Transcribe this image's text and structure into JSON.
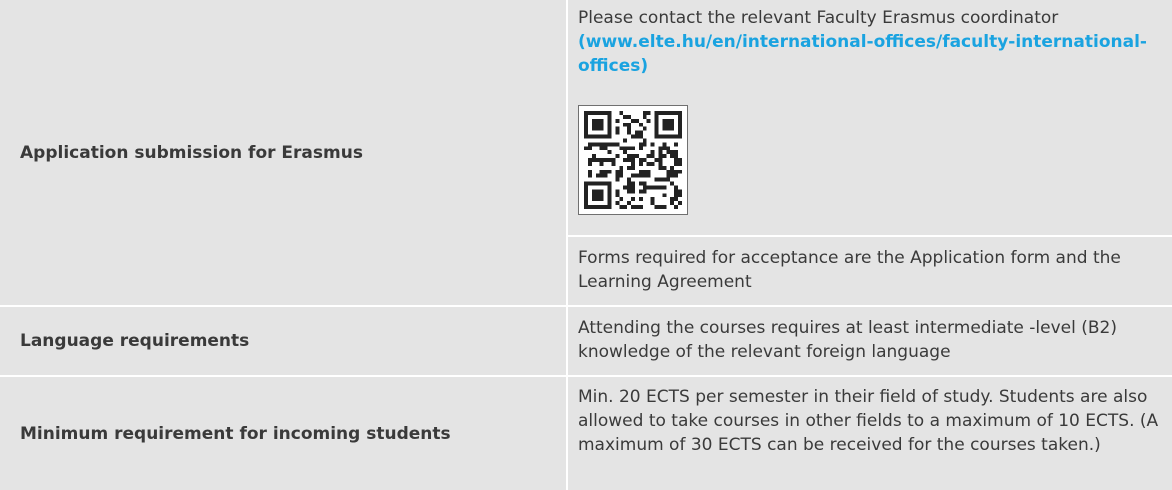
{
  "rows": [
    {
      "label": "Application submission for Erasmus",
      "contact_text": "Please contact the relevant Faculty Erasmus coordinator",
      "link_text": "(www.elte.hu/en/international-offices/faculty-international-offices)",
      "qr_icon": "qr-code-icon",
      "forms_text": "Forms required for acceptance are the Application form and the Learning Agreement"
    },
    {
      "label": "Language requirements",
      "text": "Attending the courses requires at least intermediate -level (B2) knowledge of the relevant foreign language"
    },
    {
      "label": "Minimum requirement for incoming students",
      "text": "Min. 20 ECTS per semester in their field of study. Students are also allowed to take courses in other fields to a maximum of 10 ECTS. (A maximum of 30 ECTS can be received for the courses taken.)"
    }
  ],
  "colors": {
    "cell_bg": "#e4e4e4",
    "link": "#1aa3e0",
    "text": "#3a3a3a"
  }
}
